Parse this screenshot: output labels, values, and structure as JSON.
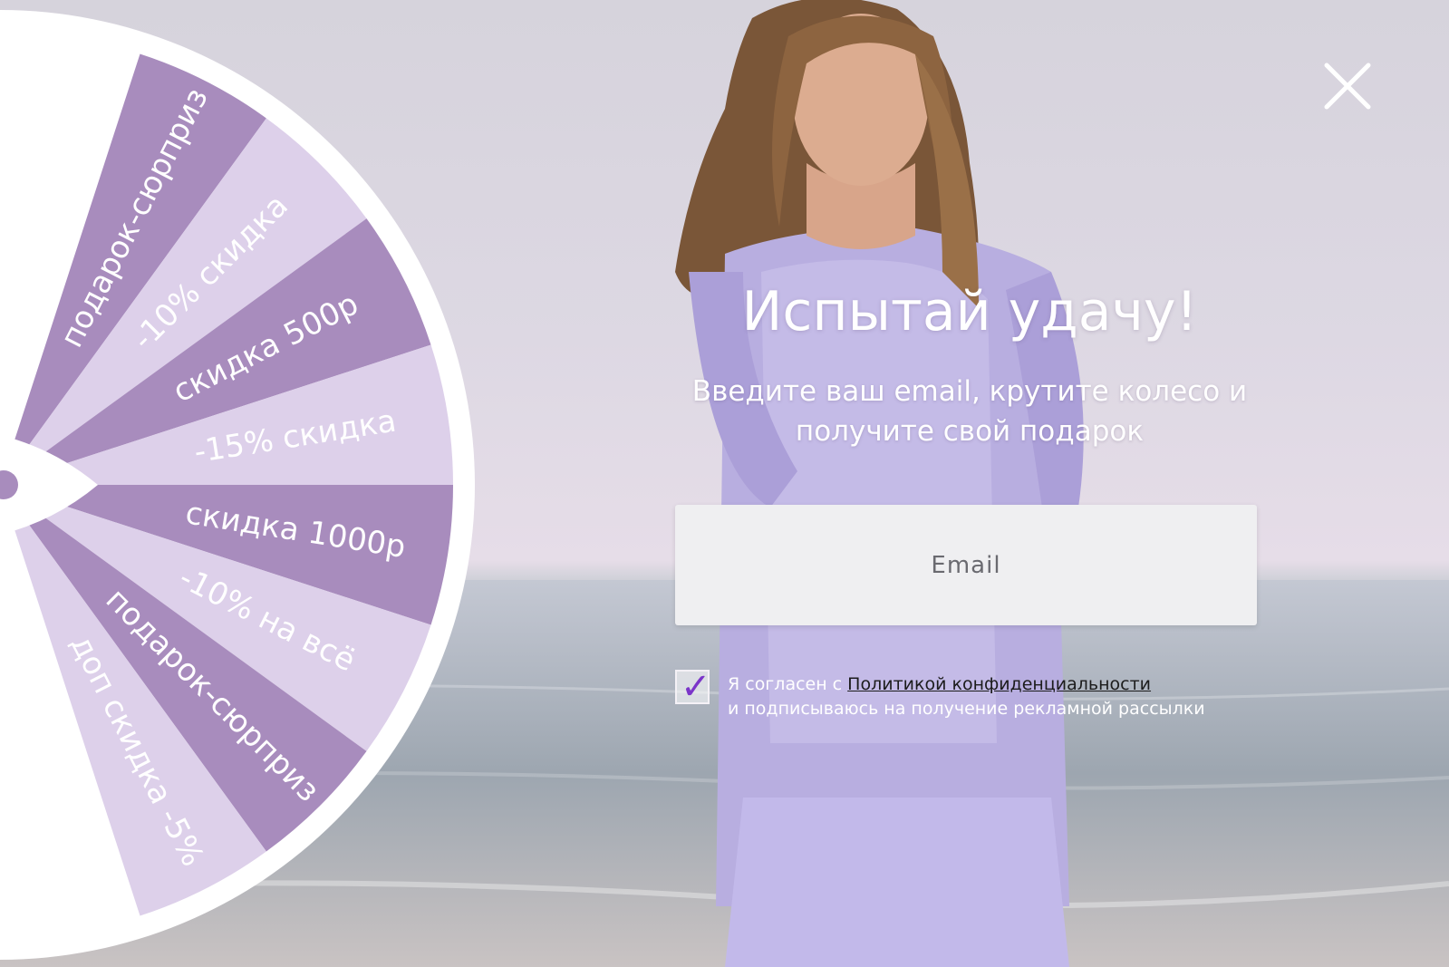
{
  "colors": {
    "wheel_dark": "#a88cbd",
    "wheel_light": "#ddd0ea",
    "wheel_rim": "#ffffff",
    "checkmark": "#7b35c9"
  },
  "wheel": {
    "segments": [
      {
        "label": "подарок-сюрприз",
        "shade": "dark"
      },
      {
        "label": "-10% скидка",
        "shade": "light"
      },
      {
        "label": "скидка 500р",
        "shade": "dark"
      },
      {
        "label": "-15% скидка",
        "shade": "light"
      },
      {
        "label": "скидка 1000р",
        "shade": "dark"
      },
      {
        "label": "-10% на всё",
        "shade": "light"
      },
      {
        "label": "подарок-сюрприз",
        "shade": "dark"
      },
      {
        "label": "доп скидка -5%",
        "shade": "light"
      }
    ]
  },
  "popup": {
    "close_icon": "close-icon",
    "title": "Испытай удачу!",
    "subtitle_line1": "Введите ваш email, крутите колесо и",
    "subtitle_line2": "получите свой подарок",
    "email_placeholder": "Email",
    "consent_checked": true,
    "consent_prefix": "Я согласен с ",
    "consent_link": "Политикой конфиденциальности",
    "consent_line2": "и подписываюсь на получение рекламной рассылки"
  }
}
